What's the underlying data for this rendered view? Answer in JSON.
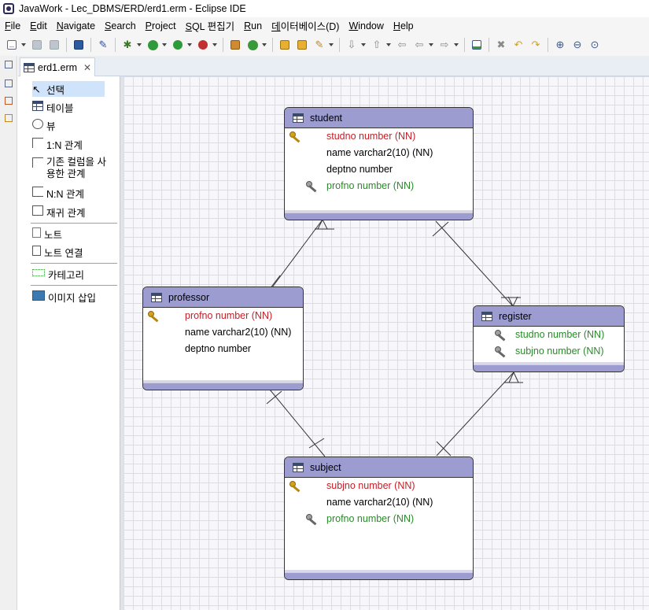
{
  "window": {
    "title": "JavaWork - Lec_DBMS/ERD/erd1.erm - Eclipse IDE"
  },
  "menu": [
    "File",
    "Edit",
    "Navigate",
    "Search",
    "Project",
    "SQL 편집기",
    "Run",
    "데이터베이스(D)",
    "Window",
    "Help"
  ],
  "editor_tab": {
    "label": "erd1.erm",
    "close_glyph": "✕"
  },
  "palette": {
    "items": [
      {
        "label": "선택",
        "icon": "cursor-icon"
      },
      {
        "label": "테이블",
        "icon": "table-icon"
      },
      {
        "label": "뷰",
        "icon": "view-icon"
      },
      {
        "label": "1:N 관계",
        "icon": "relation-1n-icon"
      },
      {
        "label": "기존 컬럼을 사용한 관계",
        "icon": "relation-existing-column-icon"
      },
      {
        "label": "N:N 관계",
        "icon": "relation-nn-icon"
      },
      {
        "label": "재귀 관계",
        "icon": "self-relation-icon"
      },
      {
        "label": "노트",
        "icon": "note-icon"
      },
      {
        "label": "노트 연결",
        "icon": "note-connection-icon"
      },
      {
        "label": "카테고리",
        "icon": "category-icon"
      },
      {
        "label": "이미지 삽입",
        "icon": "insert-image-icon"
      }
    ]
  },
  "erd": {
    "tables": [
      {
        "name": "student",
        "columns": [
          {
            "text": "studno number (NN)",
            "kind": "pk"
          },
          {
            "text": "name varchar2(10) (NN)",
            "kind": "plain"
          },
          {
            "text": "deptno number",
            "kind": "plain"
          },
          {
            "text": "profno number (NN)",
            "kind": "fk"
          }
        ]
      },
      {
        "name": "professor",
        "columns": [
          {
            "text": "profno number (NN)",
            "kind": "pk"
          },
          {
            "text": "name varchar2(10) (NN)",
            "kind": "plain"
          },
          {
            "text": "deptno number",
            "kind": "plain"
          }
        ]
      },
      {
        "name": "register",
        "columns": [
          {
            "text": "studno number (NN)",
            "kind": "fk"
          },
          {
            "text": "subjno number (NN)",
            "kind": "fk"
          }
        ]
      },
      {
        "name": "subject",
        "columns": [
          {
            "text": "subjno number (NN)",
            "kind": "pk"
          },
          {
            "text": "name varchar2(10) (NN)",
            "kind": "plain"
          },
          {
            "text": "profno number (NN)",
            "kind": "fk"
          }
        ]
      }
    ],
    "relationships": [
      {
        "from": "professor",
        "to": "student"
      },
      {
        "from": "student",
        "to": "register"
      },
      {
        "from": "professor",
        "to": "subject"
      },
      {
        "from": "subject",
        "to": "register"
      }
    ],
    "colors": {
      "header": "#9c9cd0",
      "primary_key": "#c02028",
      "foreign_key": "#2a8a2a"
    }
  }
}
